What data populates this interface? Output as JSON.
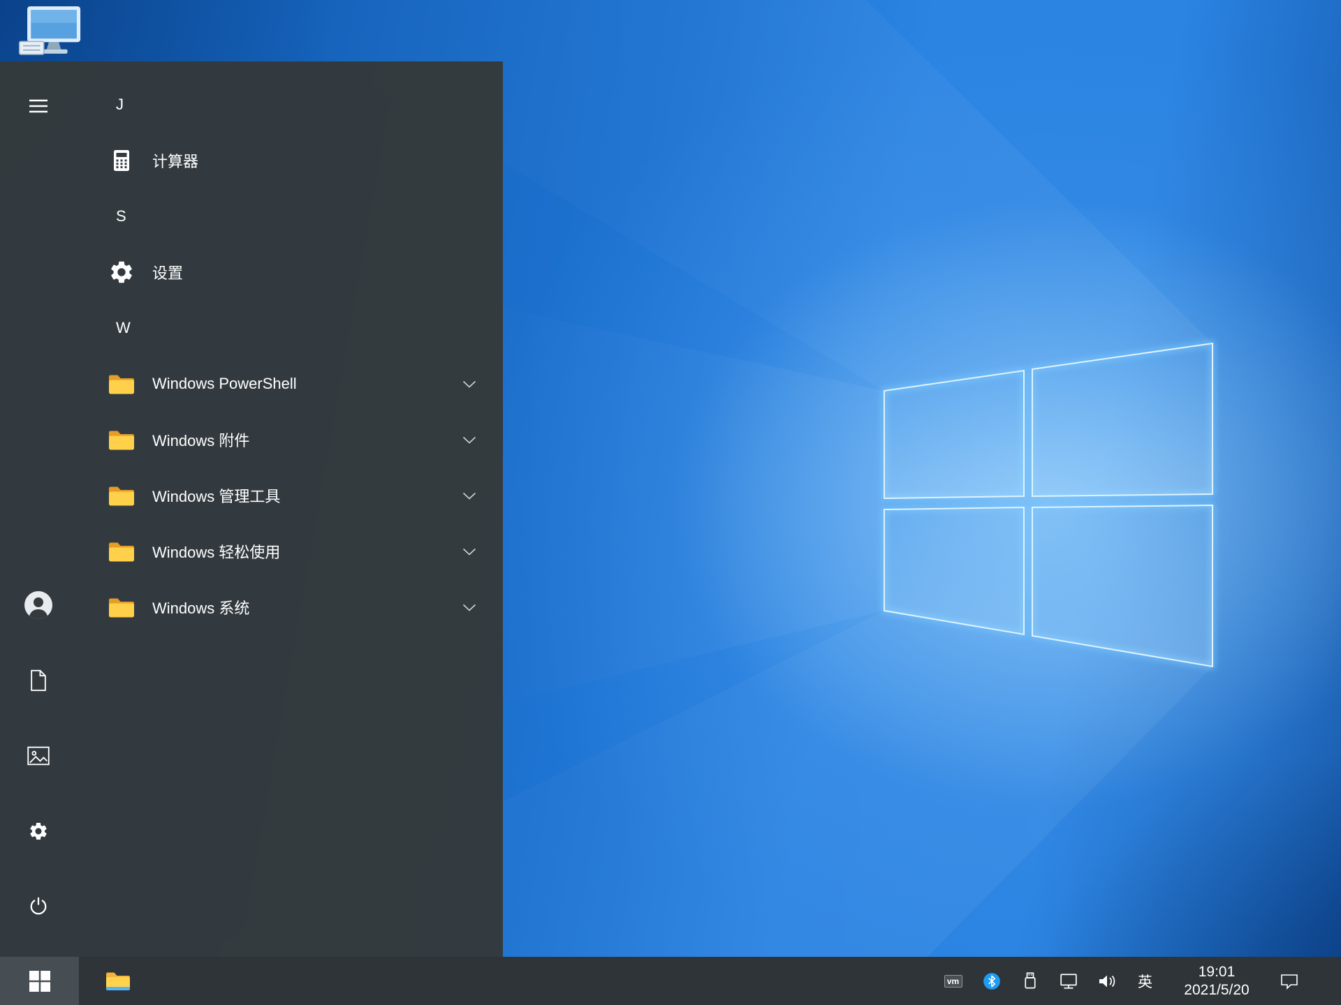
{
  "start_menu": {
    "app_list": [
      {
        "type": "letter",
        "label": "J"
      },
      {
        "type": "app",
        "label": "计算器",
        "icon": "calculator-icon"
      },
      {
        "type": "letter",
        "label": "S"
      },
      {
        "type": "app",
        "label": "设置",
        "icon": "gear-icon"
      },
      {
        "type": "letter",
        "label": "W"
      },
      {
        "type": "folder",
        "label": "Windows PowerShell",
        "icon": "folder-icon"
      },
      {
        "type": "folder",
        "label": "Windows 附件",
        "icon": "folder-icon"
      },
      {
        "type": "folder",
        "label": "Windows 管理工具",
        "icon": "folder-icon"
      },
      {
        "type": "folder",
        "label": "Windows 轻松使用",
        "icon": "folder-icon"
      },
      {
        "type": "folder",
        "label": "Windows 系统",
        "icon": "folder-icon"
      }
    ]
  },
  "taskbar": {
    "tray": {
      "vm_badge": "vm",
      "ime_label": "英",
      "time": "19:01",
      "date": "2021/5/20"
    }
  },
  "icons": {
    "rail": [
      "hamburger-menu-icon",
      "user-avatar-icon",
      "document-icon",
      "pictures-icon",
      "gear-icon",
      "power-icon"
    ],
    "tray": [
      "vmware-icon",
      "bluetooth-icon",
      "safely-remove-hardware-icon",
      "network-icon",
      "volume-icon",
      "action-center-icon"
    ],
    "other": [
      "windows-logo-icon",
      "file-explorer-icon",
      "this-pc-icon",
      "chevron-down-icon",
      "calculator-icon",
      "folder-icon"
    ]
  },
  "colors": {
    "menu_bg": "#343a3d",
    "taskbar_bg": "#2e3438",
    "start_button_active": "#474e53",
    "folder_yellow": "#ffd04a",
    "bluetooth_blue": "#1e9bf2",
    "wallpaper_blue": "#1e74d2"
  }
}
